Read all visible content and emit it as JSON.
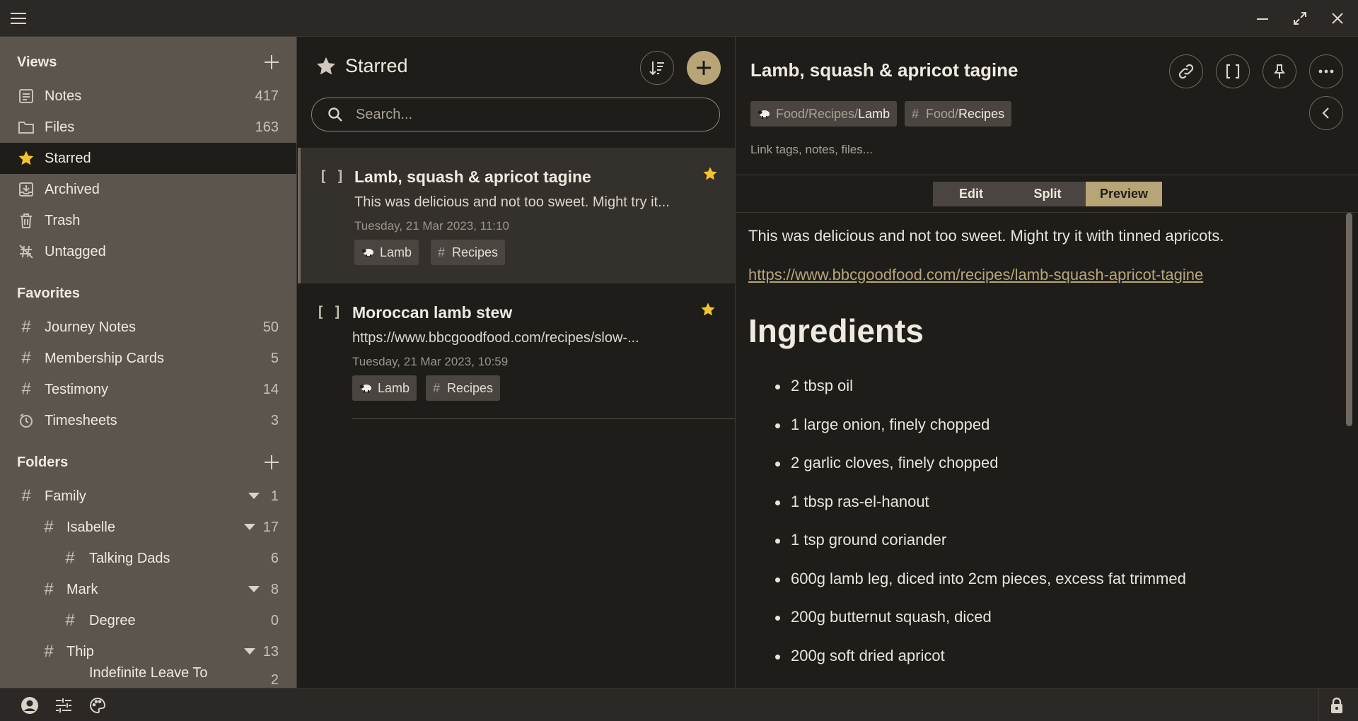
{
  "app": {
    "window_controls": {
      "menu": "menu-icon",
      "minimize": "minimize-icon",
      "maximize": "maximize-icon",
      "close": "close-icon"
    }
  },
  "sidebar": {
    "views_header": "Views",
    "views": [
      {
        "label": "Notes",
        "count": "417",
        "icon": "notes-icon"
      },
      {
        "label": "Files",
        "count": "163",
        "icon": "folder-icon"
      },
      {
        "label": "Starred",
        "count": "",
        "icon": "star-icon"
      },
      {
        "label": "Archived",
        "count": "",
        "icon": "archive-icon"
      },
      {
        "label": "Trash",
        "count": "",
        "icon": "trash-icon"
      },
      {
        "label": "Untagged",
        "count": "",
        "icon": "untagged-icon"
      }
    ],
    "favorites_header": "Favorites",
    "favorites": [
      {
        "label": "Journey Notes",
        "count": "50"
      },
      {
        "label": "Membership Cards",
        "count": "5"
      },
      {
        "label": "Testimony",
        "count": "14"
      },
      {
        "label": "Timesheets",
        "count": "3"
      }
    ],
    "folders_header": "Folders",
    "folders": [
      {
        "label": "Family",
        "count": "1"
      },
      {
        "label": "Isabelle",
        "count": "17"
      },
      {
        "label": "Talking Dads",
        "count": "6"
      },
      {
        "label": "Mark",
        "count": "8"
      },
      {
        "label": "Degree",
        "count": "0"
      },
      {
        "label": "Thip",
        "count": "13"
      },
      {
        "label": "Indefinite Leave To",
        "count": "2"
      }
    ]
  },
  "list": {
    "title": "Starred",
    "search_placeholder": "Search...",
    "notes": [
      {
        "title": "Lamb, squash & apricot tagine",
        "snippet": "This was delicious and not too sweet. Might try it...",
        "date": "Tuesday, 21 Mar 2023, 11:10",
        "tags": [
          "Lamb",
          "Recipes"
        ],
        "starred": true
      },
      {
        "title": "Moroccan lamb stew",
        "snippet": "https://www.bbcgoodfood.com/recipes/slow-...",
        "date": "Tuesday, 21 Mar 2023, 10:59",
        "tags": [
          "Lamb",
          "Recipes"
        ],
        "starred": true
      }
    ]
  },
  "editor": {
    "title": "Lamb, squash & apricot tagine",
    "tags": [
      {
        "prefix": "Food/Recipes/",
        "name": "Lamb"
      },
      {
        "prefix": "Food/",
        "name": "Recipes"
      }
    ],
    "link_hint": "Link tags, notes, files...",
    "modes": [
      "Edit",
      "Split",
      "Preview"
    ],
    "active_mode": "Preview",
    "preview": {
      "paragraph": "This was delicious and not too sweet. Might try it with tinned apricots.",
      "link": "https://www.bbcgoodfood.com/recipes/lamb-squash-apricot-tagine",
      "heading": "Ingredients",
      "ingredients": [
        "2 tbsp oil",
        "1 large onion, finely chopped",
        "2 garlic cloves, finely chopped",
        "1 tbsp ras-el-hanout",
        "1 tsp ground coriander",
        "600g lamb leg, diced into 2cm pieces, excess fat trimmed",
        "200g butternut squash, diced",
        "200g soft dried apricot"
      ]
    }
  },
  "colors": {
    "accent": "#b7a578",
    "star": "#f4c430",
    "sidebar_bg": "#5b554d",
    "main_bg": "#1f1d1a"
  }
}
